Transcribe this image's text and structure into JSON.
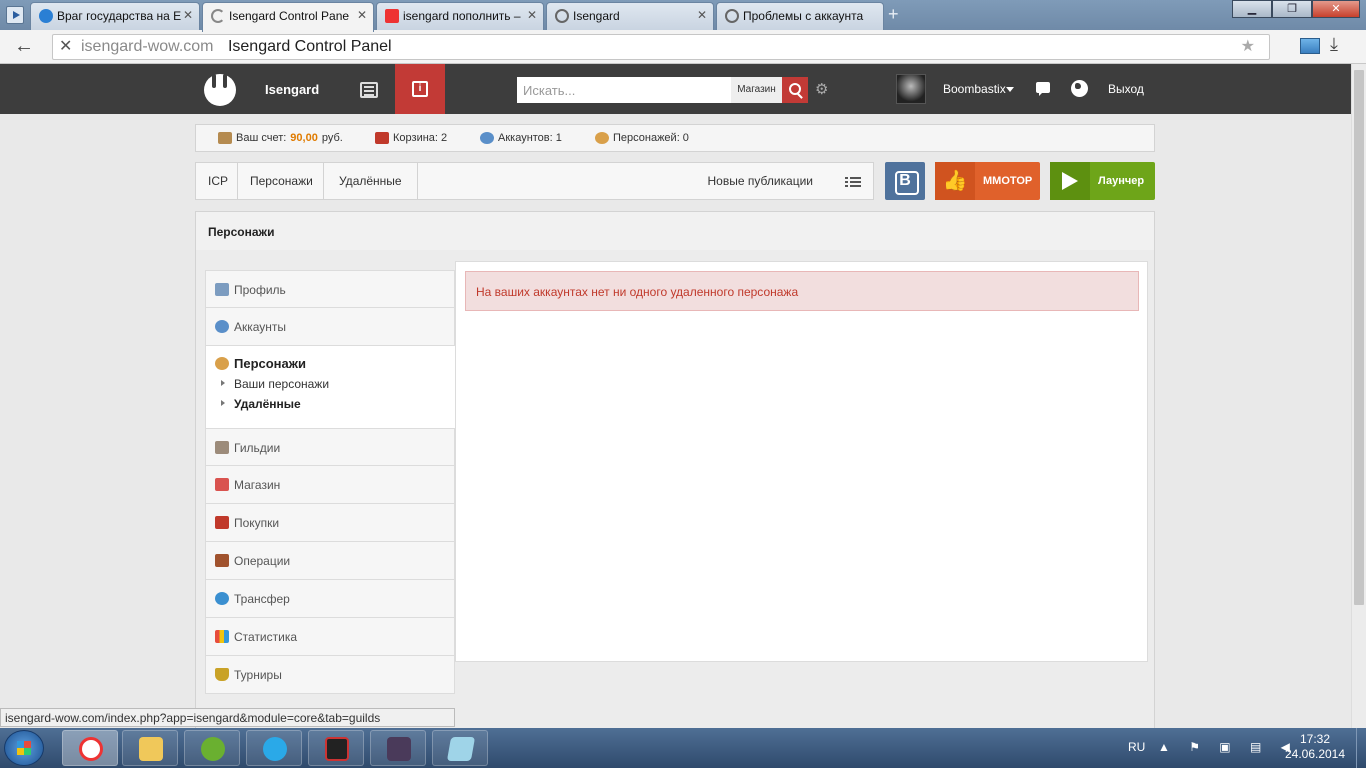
{
  "browser": {
    "tabs": [
      {
        "label": "Враг государства на Е",
        "active": false
      },
      {
        "label": "Isengard Control Pane",
        "active": true
      },
      {
        "label": "isengard пополнить –",
        "active": false
      },
      {
        "label": "Isengard",
        "active": false
      },
      {
        "label": "Проблемы с аккаунта",
        "active": false
      }
    ],
    "url_domain": "isengard-wow.com",
    "url_title": "Isengard Control Panel",
    "status_url": "isengard-wow.com/index.php?app=isengard&module=core&tab=guilds"
  },
  "topnav": {
    "site_name": "Isengard",
    "search_placeholder": "Искать...",
    "search_scope": "Магазин",
    "username": "Boombastix",
    "logout": "Выход"
  },
  "infobar": {
    "balance_label": "Ваш счет:",
    "balance_value": "90,00",
    "balance_currency": "руб.",
    "cart": "Корзина: 2",
    "accounts": "Аккаунтов: 1",
    "characters": "Персонажей: 0"
  },
  "breadcrumb": {
    "items": [
      "ICP",
      "Персонажи",
      "Удалённые"
    ],
    "new_publications": "Новые публикации"
  },
  "buttons": {
    "vk": "B",
    "mmotop": "ММОТОР",
    "launcher": "Лаунчер"
  },
  "page": {
    "title": "Персонажи",
    "alert": "На ваших аккаунтах нет ни одного удаленного персонажа"
  },
  "sidebar": {
    "items_top": [
      {
        "label": "Профиль",
        "icon": "profile-icon",
        "color": "#7c9cc0"
      },
      {
        "label": "Аккаунты",
        "icon": "account-icon",
        "color": "#5a8fc9"
      }
    ],
    "active": {
      "label": "Персонажи",
      "icon": "characters-icon",
      "sub": [
        "Ваши персонажи",
        "Удалённые"
      ]
    },
    "items_bottom": [
      {
        "label": "Гильдии",
        "icon": "guild-icon",
        "color": "#9c8b7a"
      },
      {
        "label": "Магазин",
        "icon": "shop-icon",
        "color": "#d9534f"
      },
      {
        "label": "Покупки",
        "icon": "purchases-icon",
        "color": "#c0392b"
      },
      {
        "label": "Операции",
        "icon": "wallet-icon",
        "color": "#a0522d"
      },
      {
        "label": "Трансфер",
        "icon": "transfer-icon",
        "color": "#3a8fd0"
      },
      {
        "label": "Статистика",
        "icon": "statistics-icon",
        "color": "#e67e22"
      },
      {
        "label": "Турниры",
        "icon": "trophy-icon",
        "color": "#c9a227"
      }
    ]
  },
  "taskbar": {
    "lang": "RU",
    "time": "17:32",
    "date": "24.06.2014"
  }
}
